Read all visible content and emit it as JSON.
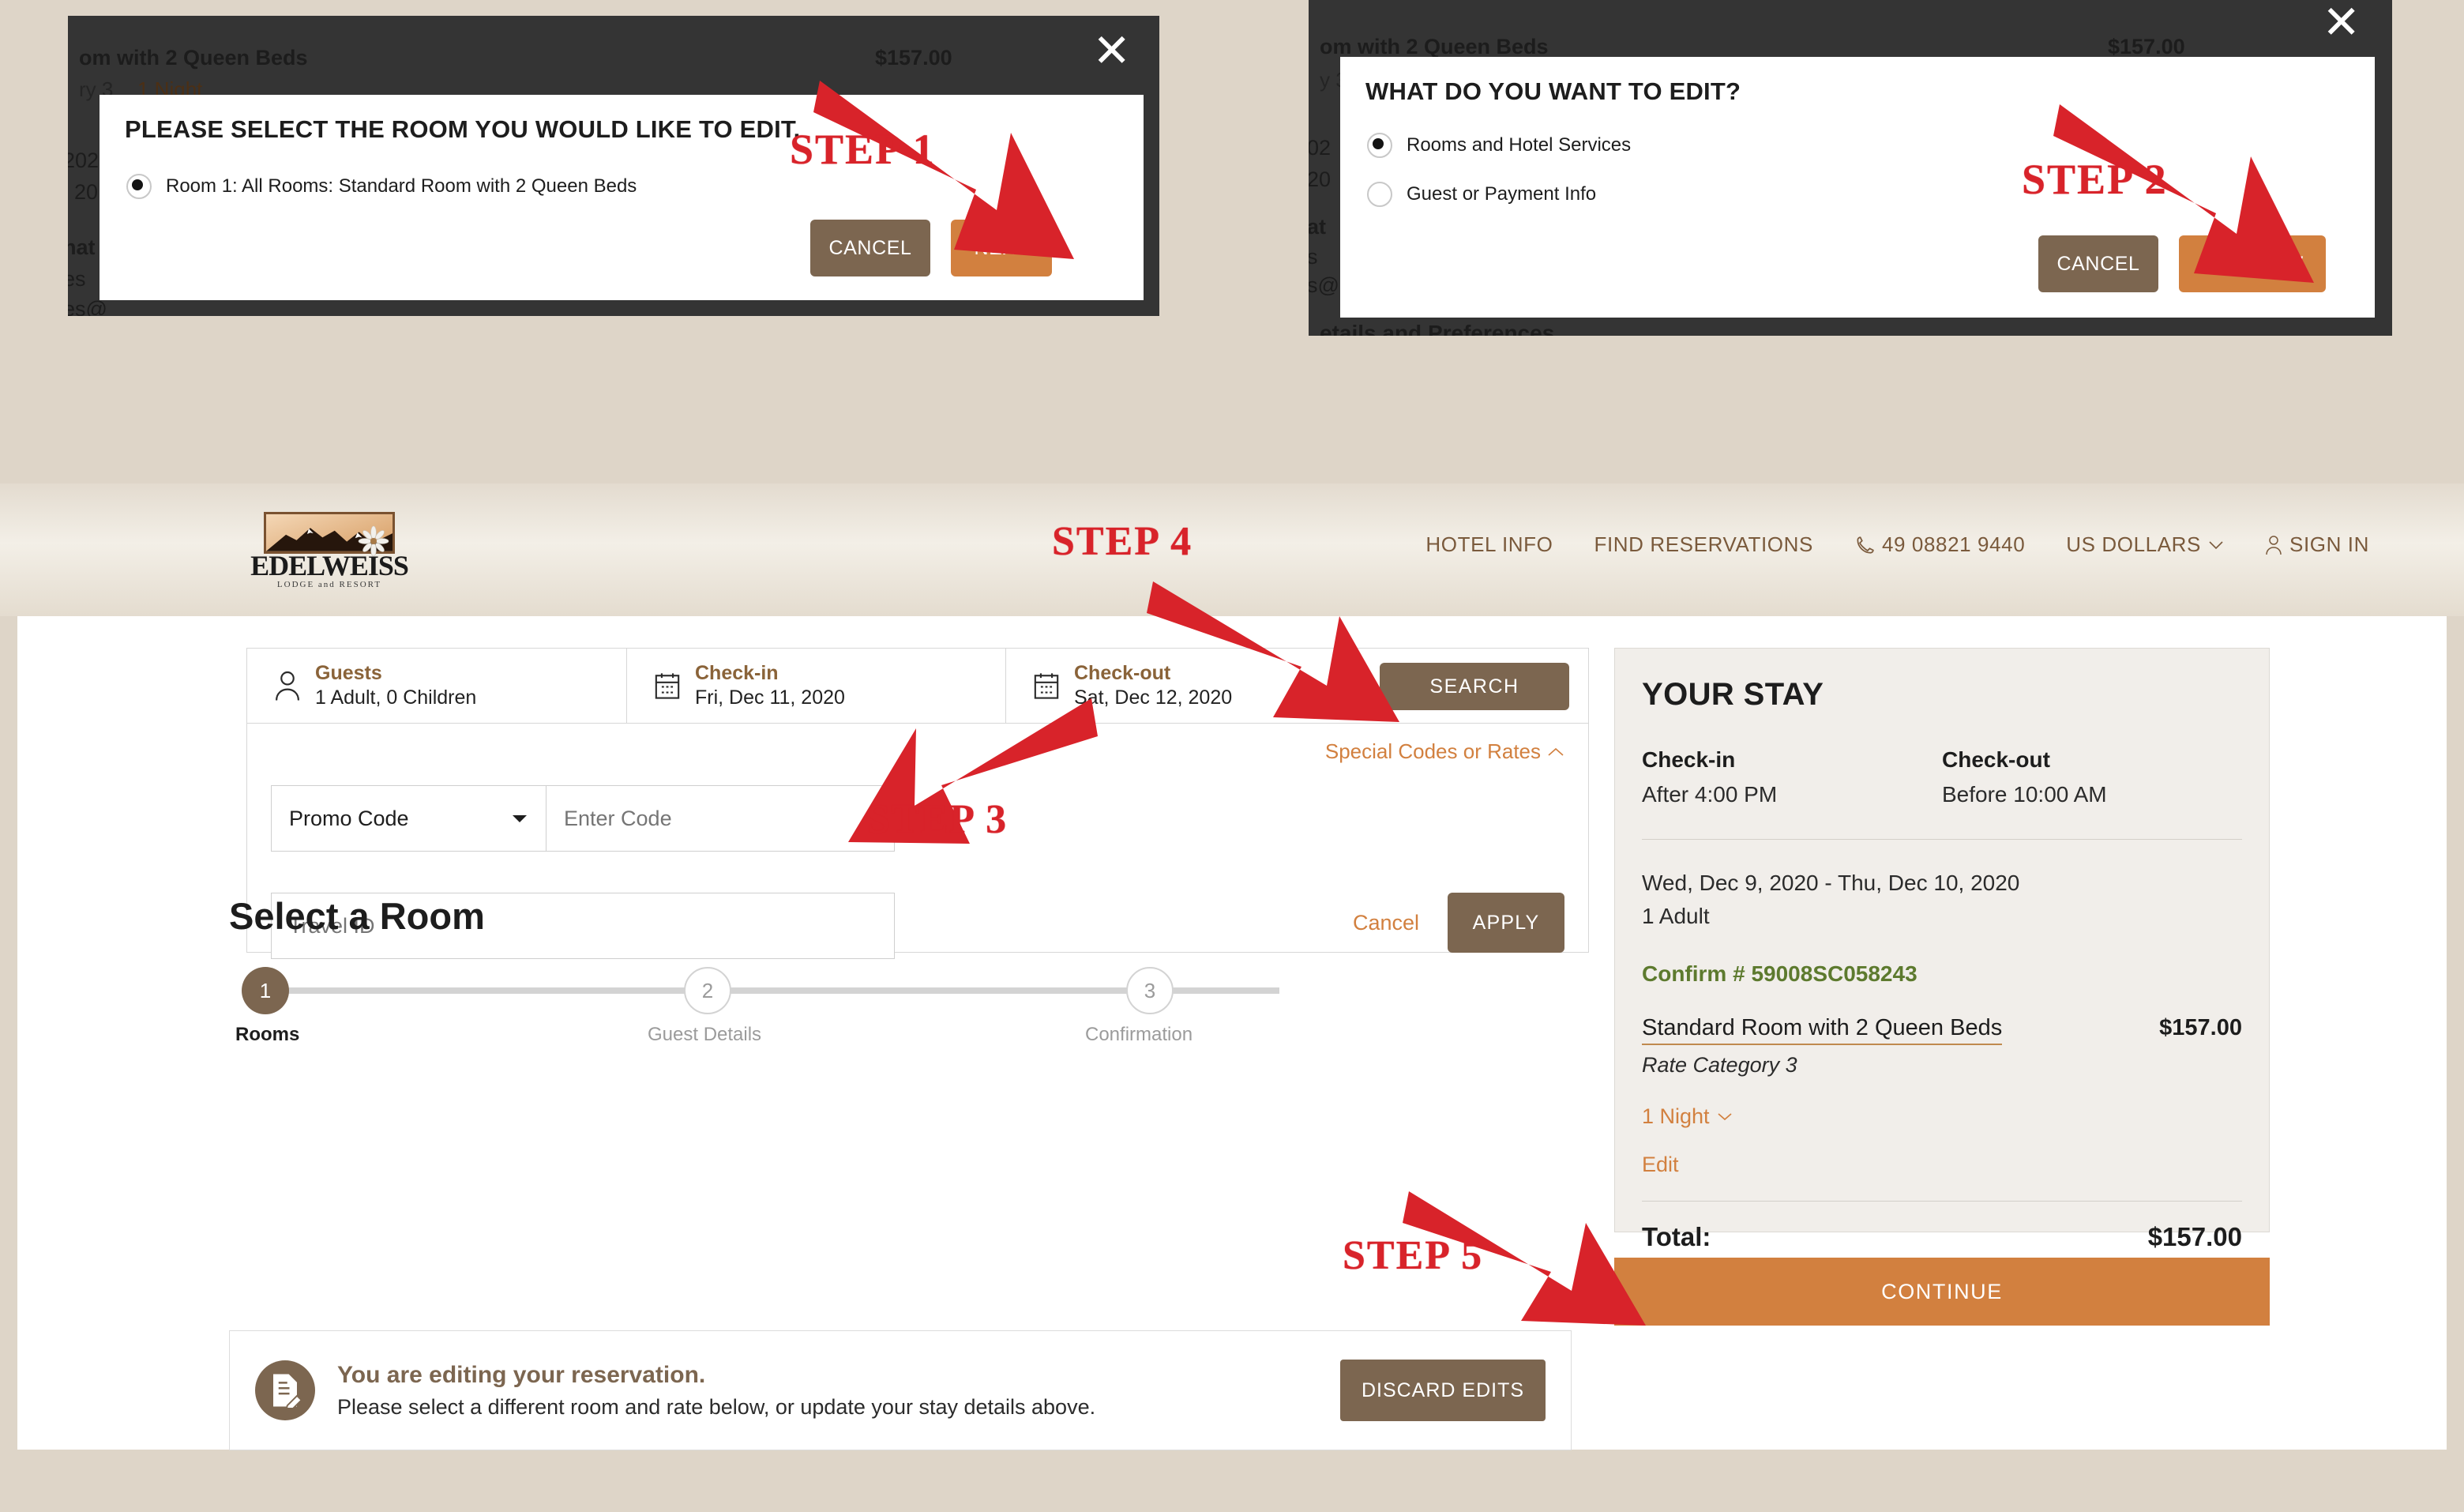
{
  "modal_step1": {
    "bg_line1": "om with 2 Queen Beds",
    "bg_price": "$157.00",
    "bg_line2": "ry 3",
    "bg_nights": "1 Night",
    "bg_frag1": "202",
    "bg_frag2": "20",
    "bg_frag3": "nat",
    "bg_frag4": "es",
    "bg_frag5": "es@",
    "close_icon": "close-icon",
    "title": "PLEASE SELECT THE ROOM YOU WOULD LIKE TO EDIT.",
    "option": "Room 1: All Rooms: Standard Room with 2 Queen Beds",
    "cancel_label": "CANCEL",
    "next_label": "NEXT",
    "step_label": "STEP 1"
  },
  "modal_step2": {
    "bg_line1": "om with 2 Queen Beds",
    "bg_price": "$157.00",
    "bg_line2": "y 3",
    "bg_frag1": "02",
    "bg_frag2": "20",
    "bg_frag3": "at",
    "bg_frag4": "s",
    "bg_frag5": "s@",
    "bg_footer": "etails and Preferences",
    "close_icon": "close-icon",
    "title": "WHAT DO YOU WANT TO EDIT?",
    "options": [
      {
        "label": "Rooms and Hotel Services",
        "selected": true
      },
      {
        "label": "Guest or Payment Info",
        "selected": false
      }
    ],
    "cancel_label": "CANCEL",
    "edit_now_label": "EDIT NOW",
    "step_label": "STEP 2"
  },
  "booking": {
    "logo": {
      "wordmark": "EDELWEISS",
      "subtitle": "LODGE and RESORT"
    },
    "nav": [
      {
        "label": "HOTEL INFO",
        "icon": null
      },
      {
        "label": "FIND RESERVATIONS",
        "icon": null
      },
      {
        "label": "49 08821 9440",
        "icon": "phone-icon"
      },
      {
        "label": "US DOLLARS",
        "icon": "chevron-down-icon"
      },
      {
        "label": "SIGN IN",
        "icon": "user-icon"
      }
    ],
    "search": {
      "guests_label": "Guests",
      "guests_value": "1 Adult, 0 Children",
      "guests_icon": "user-icon",
      "checkin_label": "Check-in",
      "checkin_value": "Fri, Dec 11, 2020",
      "checkin_icon": "calendar-icon",
      "checkout_label": "Check-out",
      "checkout_value": "Sat, Dec 12, 2020",
      "checkout_icon": "calendar-icon",
      "search_button": "SEARCH"
    },
    "promo": {
      "special_link": "Special Codes or Rates",
      "special_icon": "chevron-up-icon",
      "select_value": "Promo Code",
      "select_icon": "chevron-down-icon",
      "code_placeholder": "Enter Code",
      "code_value": "",
      "travel_placeholder": "Travel ID",
      "travel_value": "",
      "cancel_label": "Cancel",
      "apply_label": "APPLY"
    },
    "section_title": "Select a Room",
    "stepper": [
      {
        "num": "1",
        "label": "Rooms",
        "state": "active"
      },
      {
        "num": "2",
        "label": "Guest Details",
        "state": "idle"
      },
      {
        "num": "3",
        "label": "Confirmation",
        "state": "idle"
      }
    ],
    "notice": {
      "icon": "document-edit-icon",
      "heading": "You are editing your reservation.",
      "body": "Please select a different room and rate below, or update your stay details above.",
      "discard_label": "DISCARD EDITS"
    },
    "stay": {
      "title": "YOUR STAY",
      "checkin_label": "Check-in",
      "checkin_value": "After 4:00 PM",
      "checkout_label": "Check-out",
      "checkout_value": "Before 10:00 AM",
      "dates": "Wed, Dec 9, 2020 - Thu, Dec 10, 2020",
      "guests": "1 Adult",
      "confirm": "Confirm # 59008SC058243",
      "room_name": "Standard Room with 2 Queen Beds",
      "room_price": "$157.00",
      "rate_category": "Rate Category 3",
      "nights": "1 Night",
      "nights_icon": "chevron-down-icon",
      "edit_label": "Edit",
      "total_label": "Total:",
      "total_value": "$157.00"
    },
    "continue_label": "CONTINUE",
    "step3_label": "STEP 3",
    "step4_label": "STEP 4",
    "step5_label": "STEP 5"
  },
  "colors": {
    "page_bg": "#ded5c8",
    "brown": "#7c6650",
    "orange": "#d2803f",
    "red_arrow": "#d8232a",
    "green": "#5d7a2e",
    "dark_modal": "#343434"
  }
}
